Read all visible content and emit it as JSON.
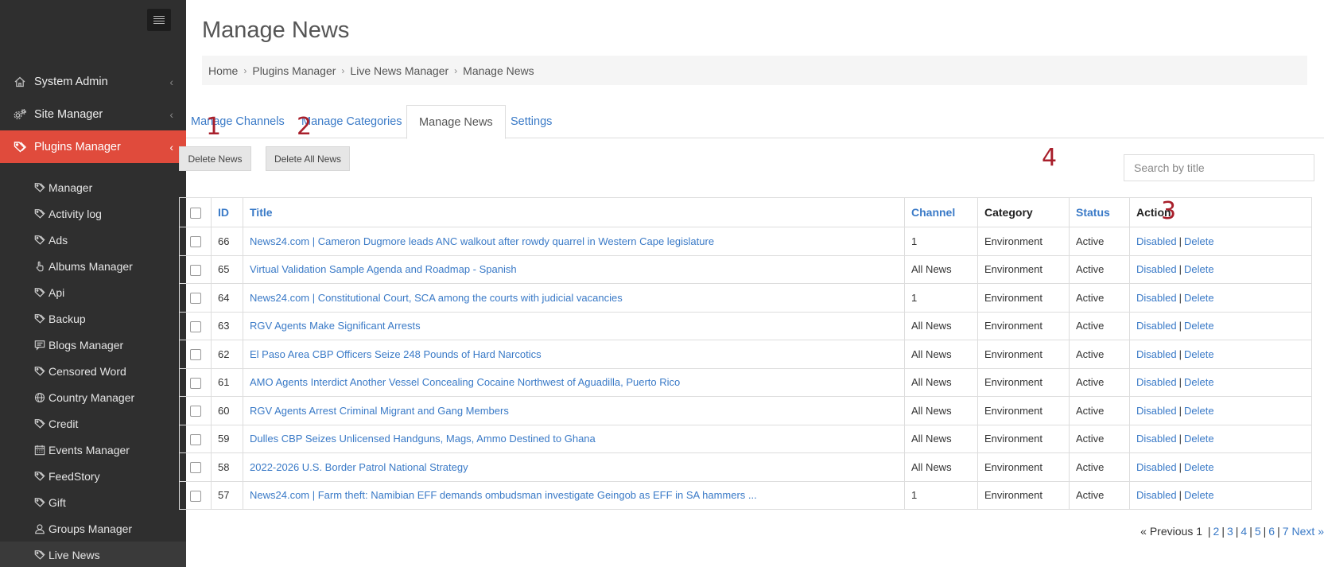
{
  "sidebar": {
    "menu": [
      {
        "label": "System Admin",
        "icon": "home-icon"
      },
      {
        "label": "Site Manager",
        "icon": "gears-icon"
      },
      {
        "label": "Plugins Manager",
        "icon": "tags-icon"
      }
    ],
    "submenu": [
      {
        "label": "Manager",
        "icon": "tag-icon"
      },
      {
        "label": "Activity log",
        "icon": "tag-icon"
      },
      {
        "label": "Ads",
        "icon": "tag-icon"
      },
      {
        "label": "Albums Manager",
        "icon": "hand-pointer-icon"
      },
      {
        "label": "Api",
        "icon": "tag-icon"
      },
      {
        "label": "Backup",
        "icon": "tag-icon"
      },
      {
        "label": "Blogs Manager",
        "icon": "comment-icon"
      },
      {
        "label": "Censored Word",
        "icon": "tag-icon"
      },
      {
        "label": "Country Manager",
        "icon": "globe-icon"
      },
      {
        "label": "Credit",
        "icon": "tag-icon"
      },
      {
        "label": "Events Manager",
        "icon": "calendar-icon"
      },
      {
        "label": "FeedStory",
        "icon": "tag-icon"
      },
      {
        "label": "Gift",
        "icon": "tag-icon"
      },
      {
        "label": "Groups Manager",
        "icon": "user-icon"
      },
      {
        "label": "Live News",
        "icon": "tag-icon"
      }
    ]
  },
  "page": {
    "title": "Manage News",
    "breadcrumb": [
      "Home",
      "Plugins Manager",
      "Live News Manager",
      "Manage News"
    ]
  },
  "tabs": [
    "Manage Channels",
    "Manage Categories",
    "Manage News",
    "Settings"
  ],
  "buttons": {
    "delete_news": "Delete News",
    "delete_all": "Delete All News"
  },
  "annotations": [
    "1",
    "2",
    "3",
    "4"
  ],
  "search": {
    "placeholder": "Search by title",
    "value": ""
  },
  "table": {
    "headers": {
      "id": "ID",
      "title": "Title",
      "channel": "Channel",
      "category": "Category",
      "status": "Status",
      "action": "Action"
    },
    "rows": [
      {
        "id": "66",
        "title": "News24.com | Cameron Dugmore leads ANC walkout after rowdy quarrel in Western Cape legislature",
        "channel": "1",
        "category": "Environment",
        "status": "Active"
      },
      {
        "id": "65",
        "title": "Virtual Validation Sample Agenda and Roadmap - Spanish",
        "channel": "All News",
        "category": "Environment",
        "status": "Active"
      },
      {
        "id": "64",
        "title": "News24.com | Constitutional Court, SCA among the courts with judicial vacancies",
        "channel": "1",
        "category": "Environment",
        "status": "Active"
      },
      {
        "id": "63",
        "title": "RGV Agents Make Significant Arrests",
        "channel": "All News",
        "category": "Environment",
        "status": "Active"
      },
      {
        "id": "62",
        "title": "El Paso Area CBP Officers Seize 248 Pounds of Hard Narcotics",
        "channel": "All News",
        "category": "Environment",
        "status": "Active"
      },
      {
        "id": "61",
        "title": "AMO Agents Interdict Another Vessel Concealing Cocaine Northwest of Aguadilla, Puerto Rico",
        "channel": "All News",
        "category": "Environment",
        "status": "Active"
      },
      {
        "id": "60",
        "title": "RGV Agents Arrest Criminal Migrant and Gang Members",
        "channel": "All News",
        "category": "Environment",
        "status": "Active"
      },
      {
        "id": "59",
        "title": "Dulles CBP Seizes Unlicensed Handguns, Mags, Ammo Destined to Ghana",
        "channel": "All News",
        "category": "Environment",
        "status": "Active"
      },
      {
        "id": "58",
        "title": "2022-2026 U.S. Border Patrol National Strategy",
        "channel": "All News",
        "category": "Environment",
        "status": "Active"
      },
      {
        "id": "57",
        "title": "News24.com | Farm theft: Namibian EFF demands ombudsman investigate Geingob as EFF in SA hammers ...",
        "channel": "1",
        "category": "Environment",
        "status": "Active"
      }
    ],
    "action_disabled": "Disabled",
    "action_sep": "|",
    "action_delete": "Delete"
  },
  "pagination": {
    "prev": "« Previous",
    "current": "1",
    "pages": [
      "2",
      "3",
      "4",
      "5",
      "6",
      "7"
    ],
    "next": "Next »"
  }
}
